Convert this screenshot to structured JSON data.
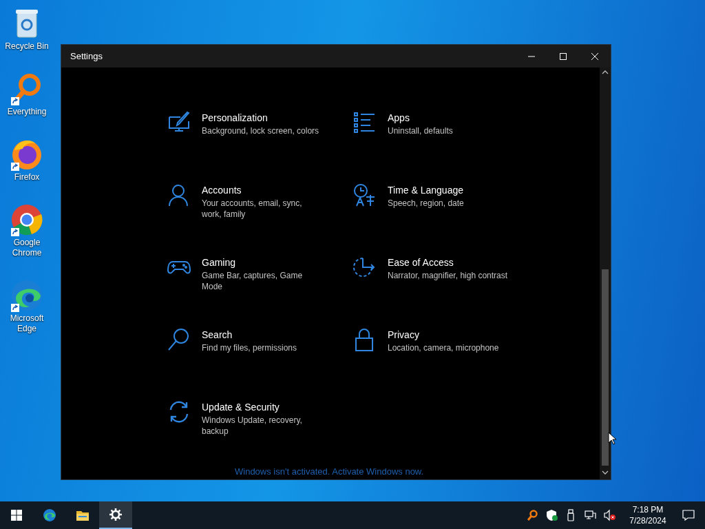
{
  "desktop_icons": [
    {
      "label": "Recycle Bin",
      "kind": "recycle",
      "shortcut": false
    },
    {
      "label": "Everything",
      "kind": "everything",
      "shortcut": true
    },
    {
      "label": "Firefox",
      "kind": "firefox",
      "shortcut": true
    },
    {
      "label": "Google Chrome",
      "kind": "chrome",
      "shortcut": true
    },
    {
      "label": "Microsoft Edge",
      "kind": "edge",
      "shortcut": true
    }
  ],
  "window": {
    "title": "Settings"
  },
  "categories": [
    {
      "kind": "personalization",
      "title": "Personalization",
      "description": "Background, lock screen, colors"
    },
    {
      "kind": "apps",
      "title": "Apps",
      "description": "Uninstall, defaults"
    },
    {
      "kind": "accounts",
      "title": "Accounts",
      "description": "Your accounts, email, sync, work, family"
    },
    {
      "kind": "time",
      "title": "Time & Language",
      "description": "Speech, region, date"
    },
    {
      "kind": "gaming",
      "title": "Gaming",
      "description": "Game Bar, captures, Game Mode"
    },
    {
      "kind": "ease",
      "title": "Ease of Access",
      "description": "Narrator, magnifier, high contrast"
    },
    {
      "kind": "search",
      "title": "Search",
      "description": "Find my files, permissions"
    },
    {
      "kind": "privacy",
      "title": "Privacy",
      "description": "Location, camera, microphone"
    },
    {
      "kind": "update",
      "title": "Update & Security",
      "description": "Windows Update, recovery, backup"
    }
  ],
  "activation_notice": "Windows isn't activated. Activate Windows now.",
  "taskbar": {
    "apps": [
      {
        "kind": "start",
        "selected": false
      },
      {
        "kind": "edge",
        "selected": false
      },
      {
        "kind": "explorer",
        "selected": false
      },
      {
        "kind": "settings",
        "selected": true
      }
    ],
    "tray": [
      {
        "kind": "everything"
      },
      {
        "kind": "defender"
      },
      {
        "kind": "usb"
      },
      {
        "kind": "network"
      },
      {
        "kind": "volume-muted"
      }
    ],
    "time": "7:18 PM",
    "date": "7/28/2024"
  }
}
